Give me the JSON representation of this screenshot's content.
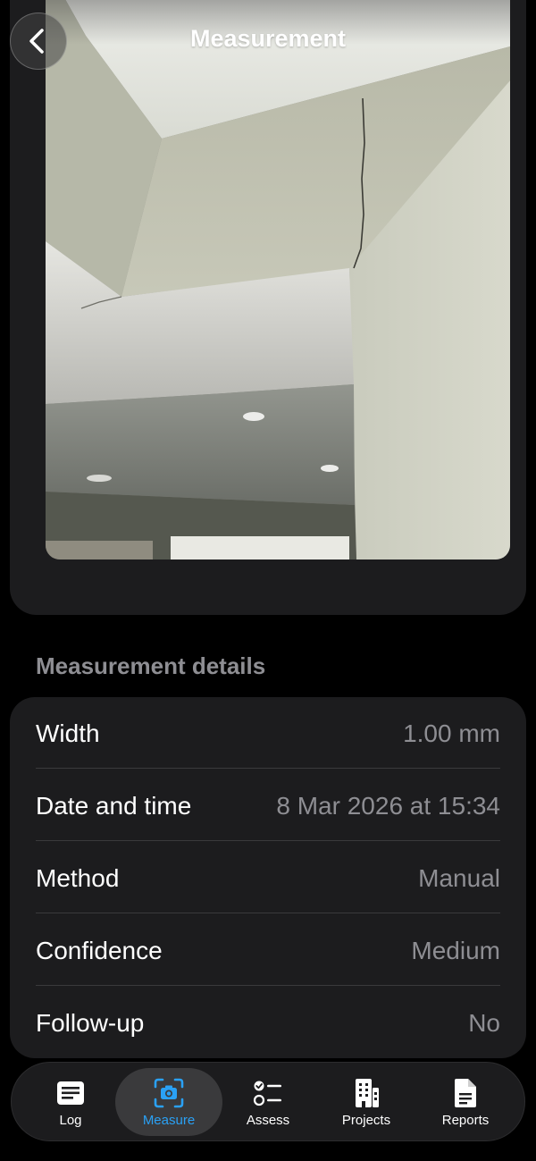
{
  "header": {
    "title": "Measurement",
    "back_icon": "chevron-left-icon"
  },
  "photo": {
    "subject": "wall-crack-photo"
  },
  "details": {
    "section_title": "Measurement details",
    "rows": [
      {
        "label": "Width",
        "value": "1.00 mm"
      },
      {
        "label": "Date and time",
        "value": "8 Mar 2026 at 15:34"
      },
      {
        "label": "Method",
        "value": "Manual"
      },
      {
        "label": "Confidence",
        "value": "Medium"
      },
      {
        "label": "Follow-up",
        "value": "No"
      }
    ]
  },
  "tabs": [
    {
      "label": "Log",
      "icon": "log-icon",
      "active": false
    },
    {
      "label": "Measure",
      "icon": "camera-scan-icon",
      "active": true
    },
    {
      "label": "Assess",
      "icon": "checklist-icon",
      "active": false
    },
    {
      "label": "Projects",
      "icon": "building-icon",
      "active": false
    },
    {
      "label": "Reports",
      "icon": "document-icon",
      "active": false
    }
  ],
  "colors": {
    "accent": "#2aa1f5",
    "card": "#1c1c1e",
    "secondary_text": "#8e8e93",
    "background": "#000000"
  }
}
